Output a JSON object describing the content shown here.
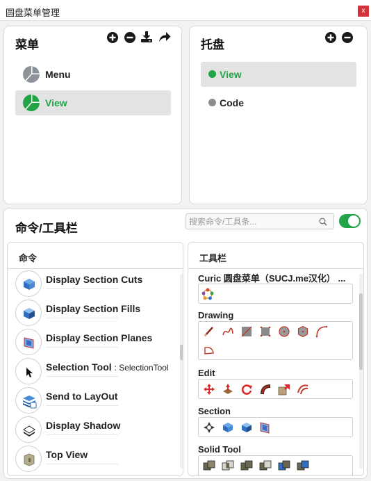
{
  "window": {
    "title": "圆盘菜单管理",
    "close_label": "x"
  },
  "menu_panel": {
    "title": "菜单",
    "items": [
      {
        "label": "Menu",
        "selected": false
      },
      {
        "label": "View",
        "selected": true
      }
    ]
  },
  "tray_panel": {
    "title": "托盘",
    "items": [
      {
        "label": "View",
        "selected": true,
        "color": "#22a447"
      },
      {
        "label": "Code",
        "selected": false,
        "color": "#8c8c8c"
      }
    ]
  },
  "toolbar_section": {
    "title": "命令/工具栏",
    "search_placeholder": "搜索命令/工具条...",
    "toggle_on": true
  },
  "commands": {
    "header": "命令",
    "items": [
      {
        "label": "Display Section Cuts",
        "sub": ""
      },
      {
        "label": "Display Section Fills",
        "sub": ""
      },
      {
        "label": "Display Section Planes",
        "sub": ""
      },
      {
        "label": "Selection Tool",
        "sub": ": SelectionTool"
      },
      {
        "label": "Send to LayOut",
        "sub": ""
      },
      {
        "label": "Display Shadow",
        "sub": ""
      },
      {
        "label": "Top View",
        "sub": ""
      }
    ]
  },
  "toolbars": {
    "header": "工具栏",
    "groups": [
      {
        "title": "Curic 圆盘菜单（SUCJ.me汉化）  ..."
      },
      {
        "title": "Drawing"
      },
      {
        "title": "Edit"
      },
      {
        "title": "Section"
      },
      {
        "title": "Solid Tool"
      }
    ]
  },
  "colors": {
    "accent_green": "#22a447",
    "close_red": "#d3343b"
  }
}
